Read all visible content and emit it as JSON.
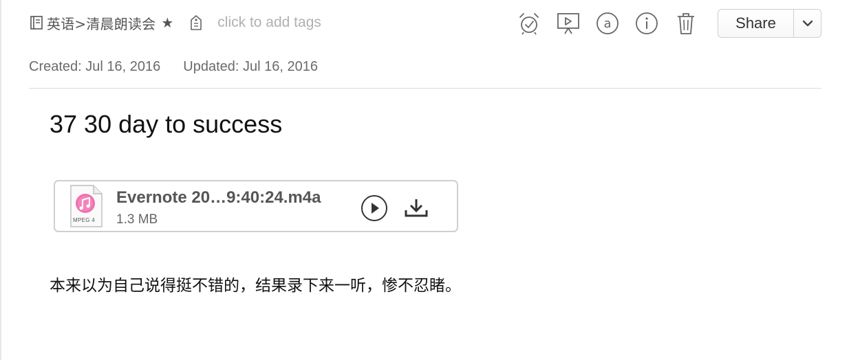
{
  "header": {
    "notebook_path": "英语>清晨朗读会",
    "star": "★",
    "tags_placeholder": "click to add tags"
  },
  "toolbar": {
    "icons": [
      "reminder-alarm-icon",
      "presentation-icon",
      "at-mention-icon",
      "info-icon",
      "trash-icon"
    ],
    "share_label": "Share"
  },
  "meta": {
    "created": "Created: Jul 16, 2016",
    "updated": "Updated: Jul 16, 2016"
  },
  "note": {
    "title": "37 30 day to success",
    "attachment": {
      "file_name": "Evernote 20…9:40:24.m4a",
      "file_size": "1.3 MB",
      "file_type_label": "MPEG 4"
    },
    "body": "本来以为自己说得挺不错的，结果录下来一听，惨不忍睹。"
  },
  "colors": {
    "text_dark": "#111111",
    "text_meta": "#6a6a6a",
    "placeholder": "#b0b0b0",
    "icon_gray": "#555555",
    "border": "#cfcfcf"
  }
}
